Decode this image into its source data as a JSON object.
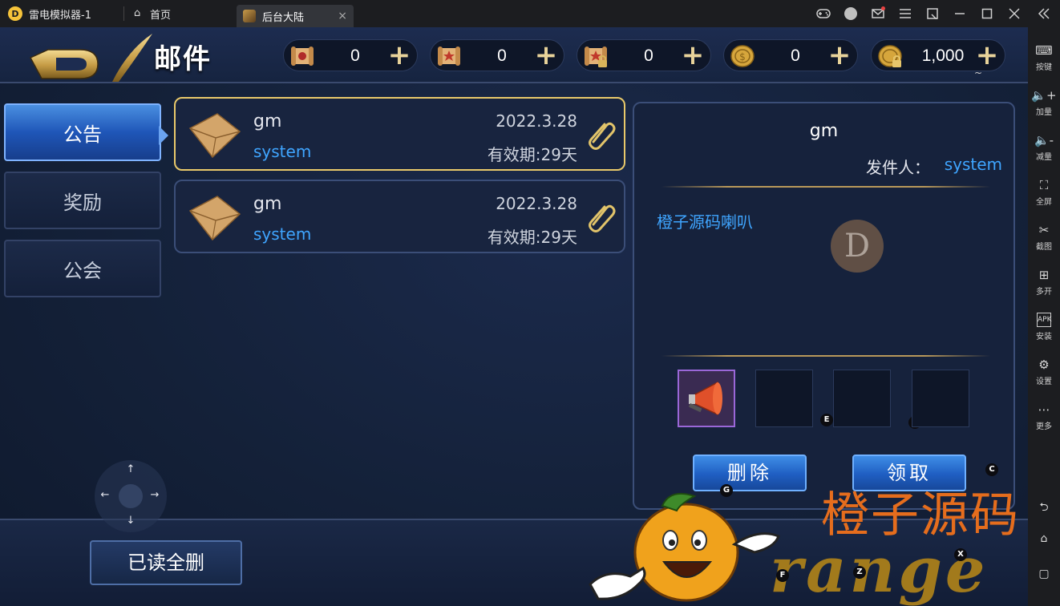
{
  "titlebar": {
    "app_title": "雷电模拟器-1",
    "home_tab": "首页",
    "game_tab": "后台大陆",
    "close_glyph": "×"
  },
  "sidebar": {
    "items": [
      {
        "label": "按键",
        "icon": "keyboard-icon"
      },
      {
        "label": "加量",
        "icon": "volume-up-icon"
      },
      {
        "label": "减量",
        "icon": "volume-down-icon"
      },
      {
        "label": "全屏",
        "icon": "fullscreen-icon"
      },
      {
        "label": "截图",
        "icon": "scissors-icon"
      },
      {
        "label": "多开",
        "icon": "multi-open-icon"
      },
      {
        "label": "安装",
        "icon": "apk-icon"
      },
      {
        "label": "设置",
        "icon": "gear-icon"
      },
      {
        "label": "更多",
        "icon": "more-icon"
      }
    ]
  },
  "header": {
    "title": "邮件",
    "resources": [
      {
        "value": "0",
        "icon": "scroll-icon"
      },
      {
        "value": "0",
        "icon": "scroll-star-icon"
      },
      {
        "value": "0",
        "icon": "scroll-locked-icon"
      },
      {
        "value": "0",
        "icon": "gold-coin-icon"
      },
      {
        "value": "1,000",
        "icon": "gold-coin-locked-icon"
      }
    ],
    "plus_glyph": "+",
    "tilde": "~"
  },
  "tabs": [
    {
      "label": "公告",
      "active": true
    },
    {
      "label": "奖励",
      "active": false
    },
    {
      "label": "公会",
      "active": false
    }
  ],
  "mails": [
    {
      "title": "gm",
      "sender": "system",
      "date": "2022.3.28",
      "expiry": "有效期:29天",
      "selected": true
    },
    {
      "title": "gm",
      "sender": "system",
      "date": "2022.3.28",
      "expiry": "有效期:29天",
      "selected": false
    }
  ],
  "detail": {
    "title": "gm",
    "from_label": "发件人：",
    "from_value": "system",
    "body": "橙子源码喇叭",
    "seal": "D",
    "slot_hints": [
      "E",
      "R"
    ],
    "delete_label": "删除",
    "claim_label": "领取",
    "delete_hint": "G",
    "claim_hint": "C"
  },
  "bottom": {
    "read_delete_label": "已读全删",
    "dpad": {
      "up": "↑",
      "down": "↓",
      "left": "←",
      "right": "→"
    },
    "key_hints": {
      "f": "F",
      "z": "Z",
      "x": "X"
    }
  },
  "watermark": {
    "text": "橙子源码",
    "brand": "range"
  },
  "colors": {
    "accent_blue": "#3fa5ff",
    "selected_border": "#e9c96a",
    "panel_bg": "#16223c"
  }
}
